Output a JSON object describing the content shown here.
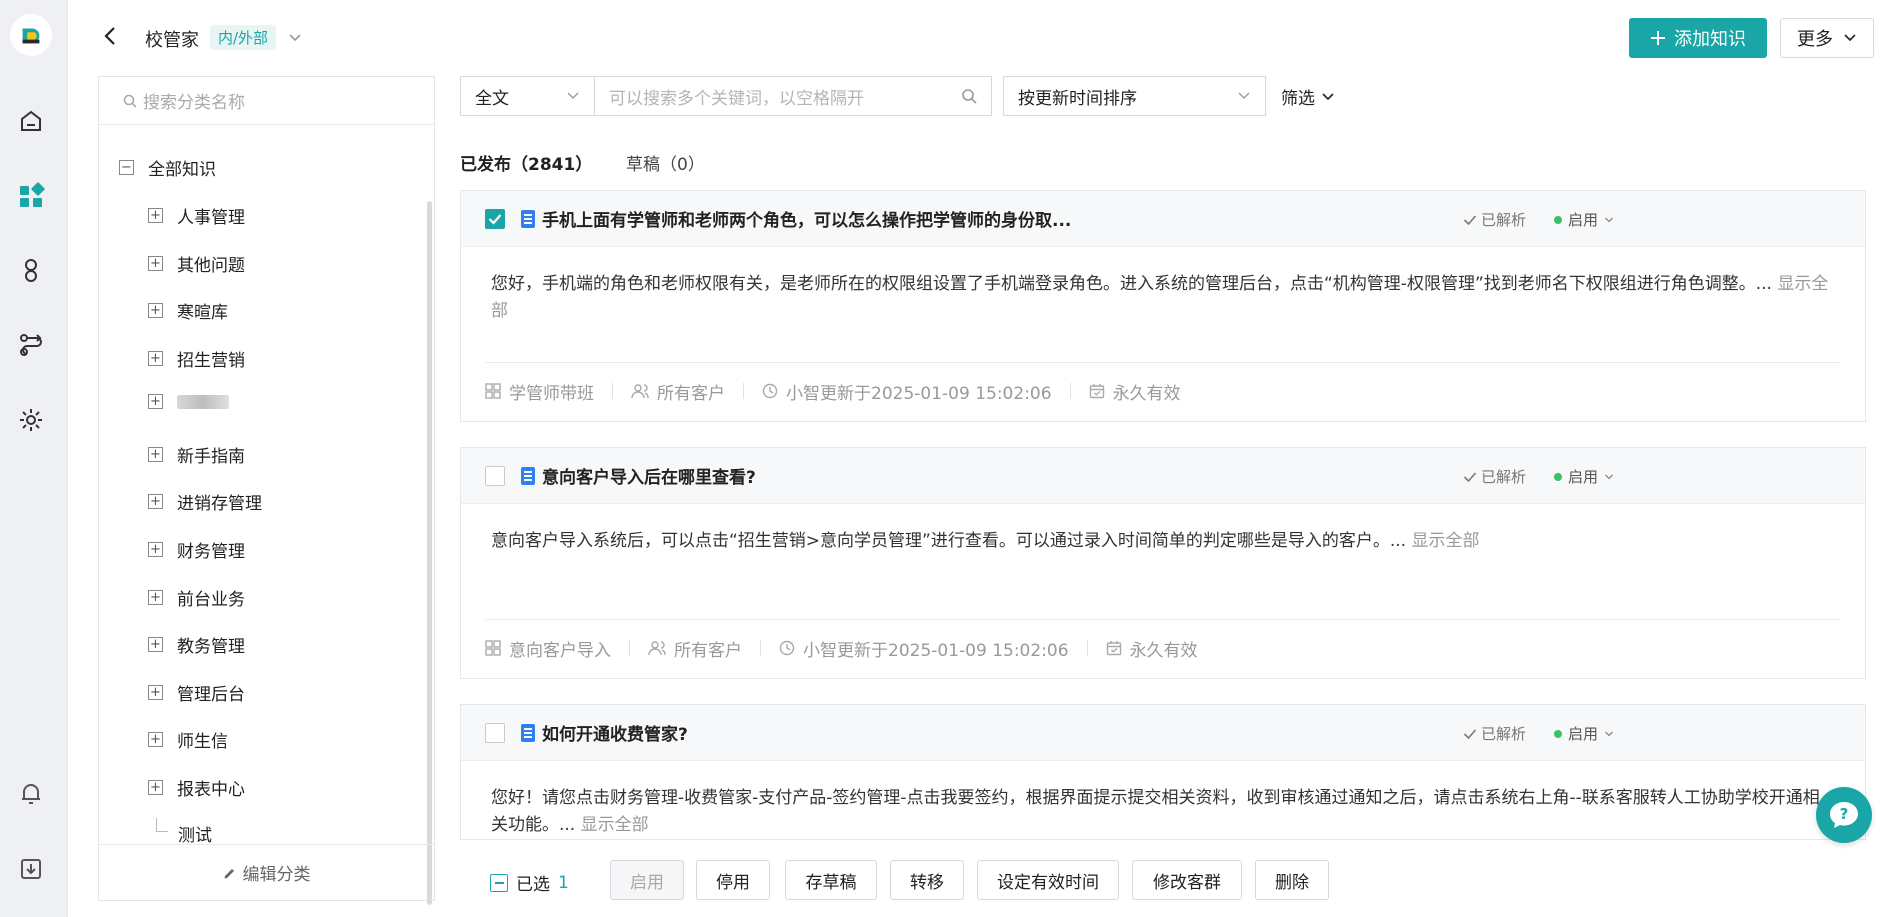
{
  "header": {
    "title": "校管家",
    "scope_tag": "内/外部",
    "add_button": "添加知识",
    "more_button": "更多"
  },
  "rail": {
    "icons": [
      "home-icon",
      "apps-icon",
      "user-icon",
      "flow-icon",
      "settings-icon",
      "bell-icon",
      "download-icon"
    ]
  },
  "category_panel": {
    "search_placeholder": "搜索分类名称",
    "root": "全部知识",
    "items": [
      "人事管理",
      "其他问题",
      "寒暄库",
      "招生营销",
      "",
      "新手指南",
      "进销存管理",
      "财务管理",
      "前台业务",
      "教务管理",
      "管理后台",
      "师生信",
      "报表中心",
      "测试"
    ],
    "footer": "编辑分类"
  },
  "filters": {
    "scope_select": "全文",
    "keyword_placeholder": "可以搜索多个关键词，以空格隔开",
    "sort_select": "按更新时间排序",
    "filter_label": "筛选"
  },
  "tabs": {
    "published": "已发布（2841）",
    "draft": "草稿（0）"
  },
  "cards": [
    {
      "title": "手机上面有学管师和老师两个角色，可以怎么操作把学管师的身份取...",
      "parsed": "已解析",
      "status": "启用",
      "body": "您好，手机端的角色和老师权限有关，是老师所在的权限组设置了手机端登录角色。进入系统的管理后台，点击“机构管理-权限管理”找到老师名下权限组进行角色调整。...",
      "show_all": "显示全部",
      "category": "学管师带班",
      "audience": "所有客户",
      "updated": "小智更新于2025-01-09 15:02:06",
      "validity": "永久有效",
      "checked": true
    },
    {
      "title": "意向客户导入后在哪里查看?",
      "parsed": "已解析",
      "status": "启用",
      "body": "意向客户导入系统后，可以点击“招生营销>意向学员管理”进行查看。可以通过录入时间简单的判定哪些是导入的客户。...",
      "show_all": "显示全部",
      "category": "意向客户导入",
      "audience": "所有客户",
      "updated": "小智更新于2025-01-09 15:02:06",
      "validity": "永久有效",
      "checked": false
    },
    {
      "title": "如何开通收费管家?",
      "parsed": "已解析",
      "status": "启用",
      "body": "您好！请您点击财务管理-收费管家-支付产品-签约管理-点击我要签约，根据界面提示提交相关资料，收到审核通过通知之后，请点击系统右上角--联系客服转人工协助学校开通相关功能。...",
      "show_all": "显示全部",
      "checked": false
    }
  ],
  "action_bar": {
    "selected_label": "已选",
    "selected_count": "1",
    "enable": "启用",
    "disable": "停用",
    "save_draft": "存草稿",
    "transfer": "转移",
    "set_validity": "设定有效时间",
    "edit_audience": "修改客群",
    "delete": "删除"
  },
  "colors": {
    "accent": "#1aa6a6",
    "status_green": "#39c164",
    "doc_blue": "#2f80ed"
  }
}
